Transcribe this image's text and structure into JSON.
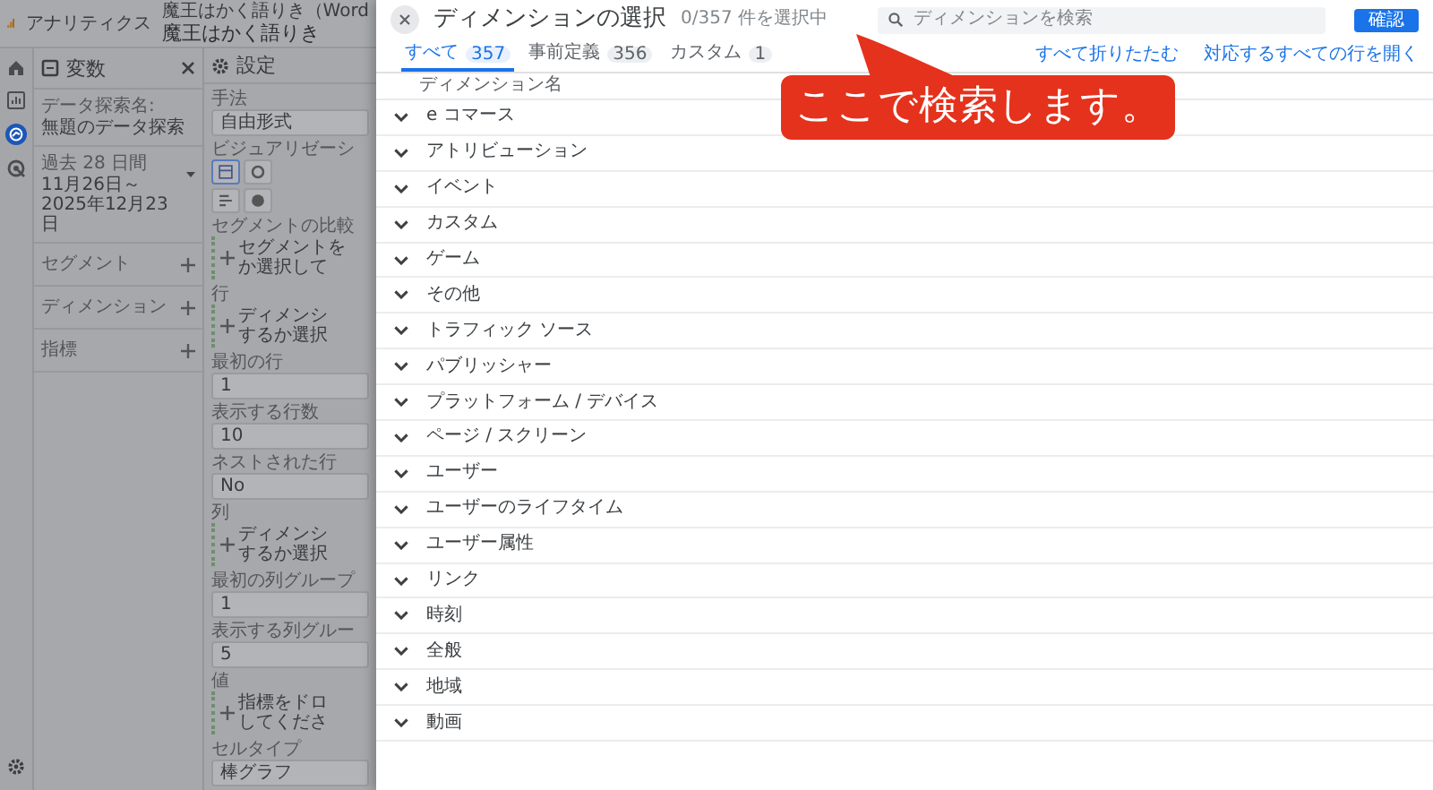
{
  "header": {
    "product": "アナリティクス",
    "account": "魔王はかく語りき（Word",
    "property": "魔王はかく語りき"
  },
  "rail": [
    {
      "kind": "home",
      "selected": false
    },
    {
      "kind": "reports",
      "selected": false
    },
    {
      "kind": "explore",
      "selected": true
    },
    {
      "kind": "advertising",
      "selected": false
    }
  ],
  "variables": {
    "title": "変数",
    "name_label": "データ探索名:",
    "name": "無題のデータ探索",
    "date_range_label": "過去 28 日間",
    "date_range": "11月26日～2025年12月23日",
    "sections": [
      "セグメント",
      "ディメンション",
      "指標"
    ]
  },
  "settings": {
    "title": "設定",
    "items": [
      {
        "kind": "field",
        "label": "手法",
        "value": "自由形式"
      },
      {
        "kind": "visualizations",
        "label": "ビジュアリゼーシ"
      },
      {
        "kind": "dropzone",
        "label": "セグメントの比較",
        "lines": [
          "セグメントを",
          "か選択して"
        ]
      },
      {
        "kind": "dropzone",
        "label": "行",
        "lines": [
          "ディメンシ",
          "するか選択"
        ]
      },
      {
        "kind": "field",
        "label": "最初の行",
        "value": "1"
      },
      {
        "kind": "field",
        "label": "表示する行数",
        "value": "10"
      },
      {
        "kind": "field",
        "label": "ネストされた行",
        "value": "No"
      },
      {
        "kind": "dropzone",
        "label": "列",
        "lines": [
          "ディメンシ",
          "するか選択"
        ]
      },
      {
        "kind": "field",
        "label": "最初の列グループ",
        "value": "1"
      },
      {
        "kind": "field",
        "label": "表示する列グルー",
        "value": "5"
      },
      {
        "kind": "dropzone",
        "label": "値",
        "lines": [
          "指標をドロ",
          "してくださ"
        ]
      },
      {
        "kind": "field",
        "label": "セルタイプ",
        "value": "棒グラフ"
      }
    ]
  },
  "dialog": {
    "title": "ディメンションの選択",
    "subtitle": "0/357 件を選択中",
    "search": {
      "placeholder": "ディメンションを検索"
    },
    "confirm": "確認",
    "tabs": [
      {
        "label": "すべて",
        "count": "357",
        "selected": true
      },
      {
        "label": "事前定義",
        "count": "356",
        "selected": false
      },
      {
        "label": "カスタム",
        "count": "1",
        "selected": false
      }
    ],
    "actions": [
      "すべて折りたたむ",
      "対応するすべての行を開く"
    ],
    "column": "ディメンション名",
    "categories": [
      "e コマース",
      "アトリビューション",
      "イベント",
      "カスタム",
      "ゲーム",
      "その他",
      "トラフィック ソース",
      "パブリッシャー",
      "プラットフォーム / デバイス",
      "ページ / スクリーン",
      "ユーザー",
      "ユーザーのライフタイム",
      "ユーザー属性",
      "リンク",
      "時刻",
      "全般",
      "地域",
      "動画"
    ]
  },
  "callout": "ここで検索します。"
}
